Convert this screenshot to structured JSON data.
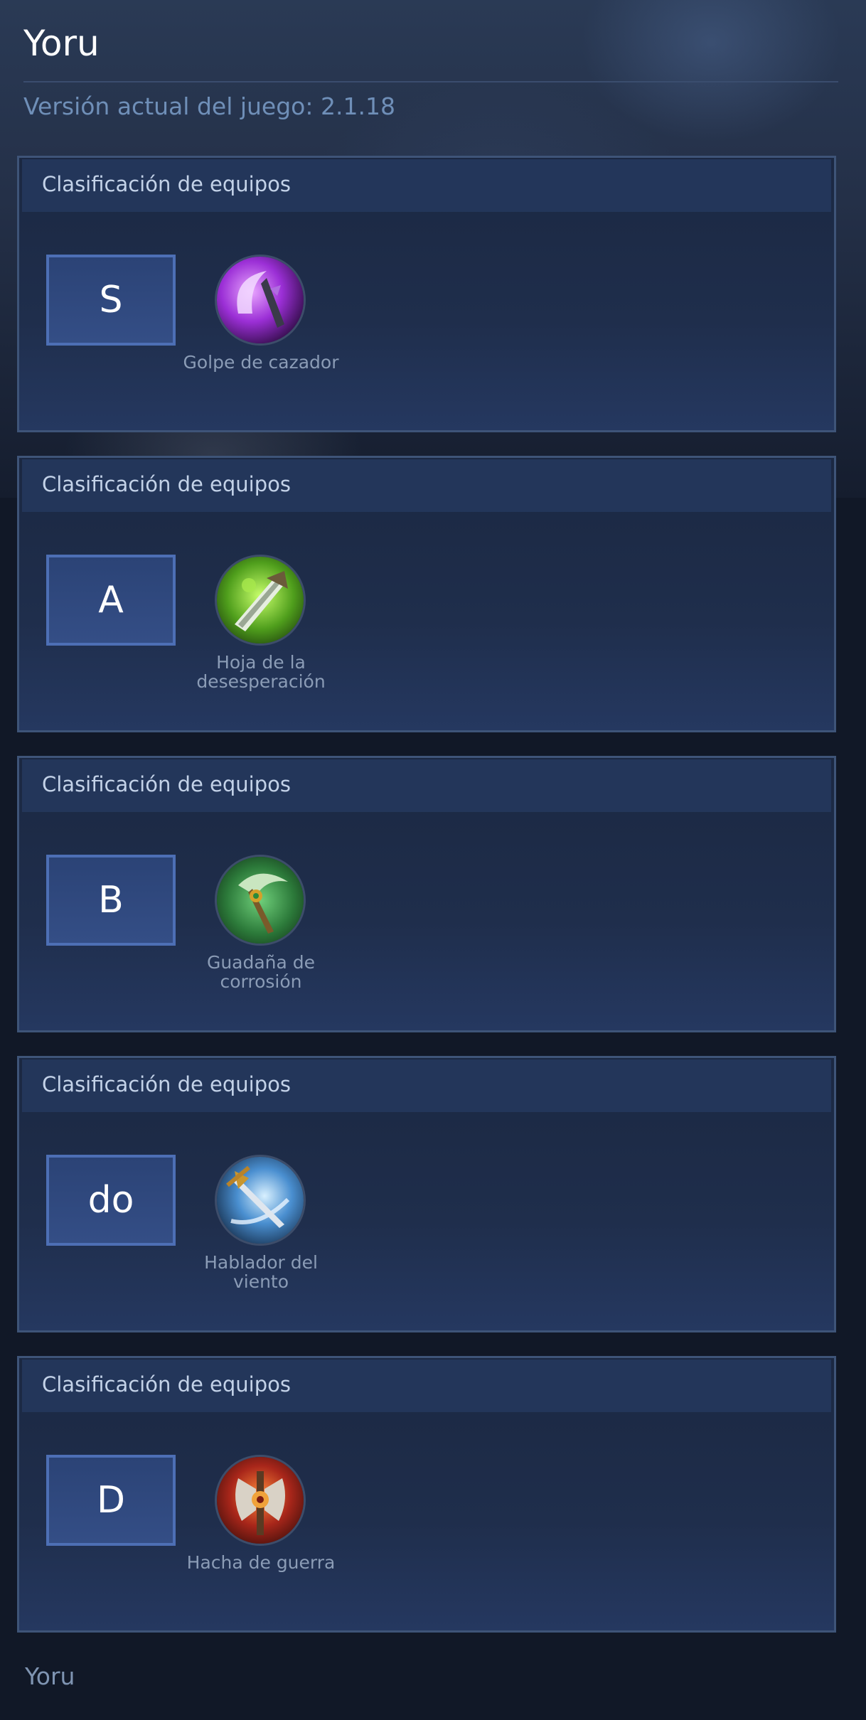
{
  "page": {
    "title": "Yoru",
    "version_text": "Versión actual del juego: 2.1.18",
    "footer_text": "Yoru"
  },
  "colors": {
    "background": "#111827",
    "card_border": "#3e5478",
    "card_header": "#23365a",
    "tier_box_border": "#4d6fb5",
    "version_text": "#6f8fb8",
    "item_label": "#8b9cb6"
  },
  "tiers": [
    {
      "section_title": "Clasificación de equipos",
      "tier": "S",
      "item": {
        "name": "Golpe de cazador",
        "icon": "purple-scythe-icon"
      }
    },
    {
      "section_title": "Clasificación de equipos",
      "tier": "A",
      "item": {
        "name": "Hoja de la desesperación",
        "icon": "green-blade-icon"
      }
    },
    {
      "section_title": "Clasificación de equipos",
      "tier": "B",
      "item": {
        "name": "Guadaña de corrosión",
        "icon": "corrosion-scythe-icon"
      }
    },
    {
      "section_title": "Clasificación de equipos",
      "tier": "do",
      "item": {
        "name": "Hablador del viento",
        "icon": "wind-sword-icon"
      }
    },
    {
      "section_title": "Clasificación de equipos",
      "tier": "D",
      "item": {
        "name": "Hacha de guerra",
        "icon": "war-axe-icon"
      }
    }
  ]
}
